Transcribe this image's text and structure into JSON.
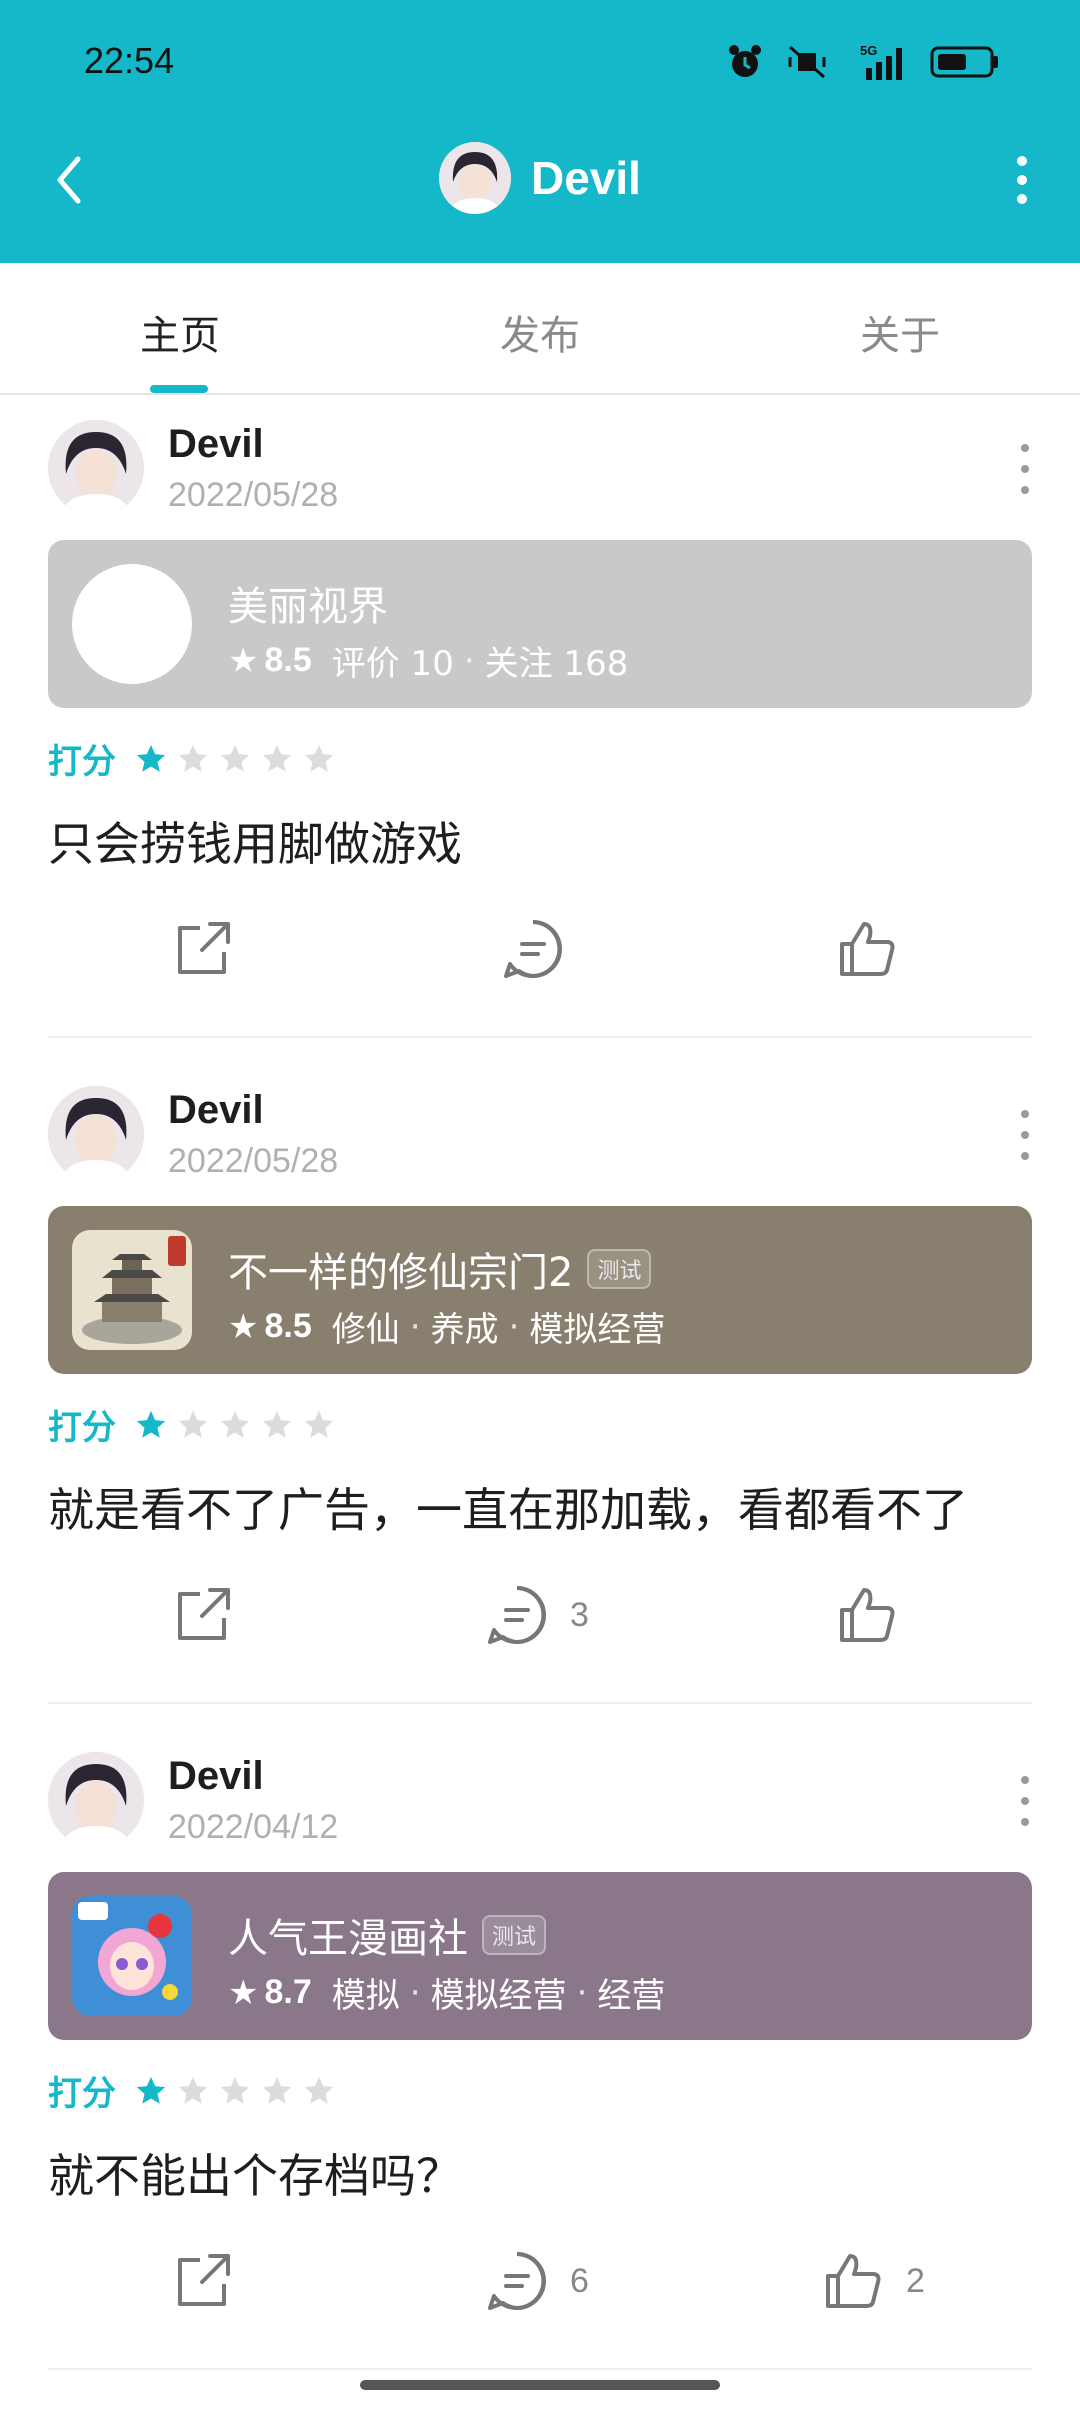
{
  "status_bar": {
    "time": "22:54",
    "network": "5G"
  },
  "nav": {
    "title": "Devil",
    "back_icon": "back-chevron-icon",
    "more_icon": "more-vertical-icon"
  },
  "tabs": [
    {
      "label": "主页",
      "active": true
    },
    {
      "label": "发布",
      "active": false
    },
    {
      "label": "关于",
      "active": false
    }
  ],
  "accent_color": "#14b8c8",
  "posts": [
    {
      "author": "Devil",
      "date": "2022/05/28",
      "app": {
        "name": "美丽视界",
        "badge": "",
        "score": "8.5",
        "meta": [
          "评价 10",
          "关注 168"
        ],
        "card_color": "#c9c9c9"
      },
      "rating_label": "打分",
      "stars": 1,
      "review": "只会捞钱用脚做游戏",
      "comments": "",
      "likes": ""
    },
    {
      "author": "Devil",
      "date": "2022/05/28",
      "app": {
        "name": "不一样的修仙宗门2",
        "badge": "测试",
        "score": "8.5",
        "meta": [
          "修仙",
          "养成",
          "模拟经营"
        ],
        "card_color": "#887f6e"
      },
      "rating_label": "打分",
      "stars": 1,
      "review": "就是看不了广告，一直在那加载，看都看不了",
      "comments": "3",
      "likes": ""
    },
    {
      "author": "Devil",
      "date": "2022/04/12",
      "app": {
        "name": "人气王漫画社",
        "badge": "测试",
        "score": "8.7",
        "meta": [
          "模拟",
          "模拟经营",
          "经营"
        ],
        "card_color": "#8a788a"
      },
      "rating_label": "打分",
      "stars": 1,
      "review": "就不能出个存档吗？",
      "comments": "6",
      "likes": "2"
    }
  ]
}
